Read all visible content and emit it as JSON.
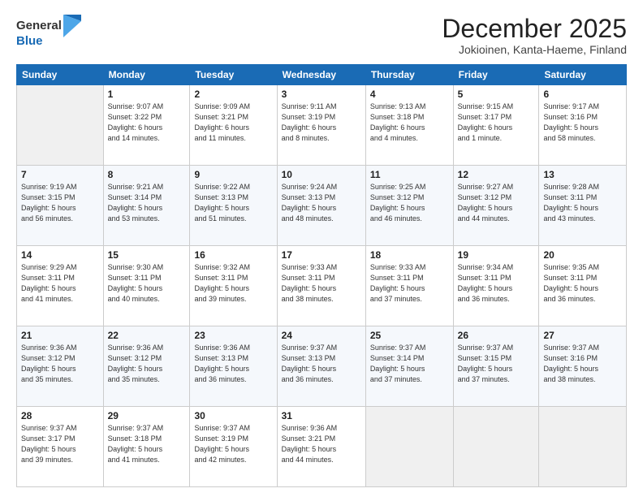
{
  "header": {
    "logo_general": "General",
    "logo_blue": "Blue",
    "month": "December 2025",
    "location": "Jokioinen, Kanta-Haeme, Finland"
  },
  "days_of_week": [
    "Sunday",
    "Monday",
    "Tuesday",
    "Wednesday",
    "Thursday",
    "Friday",
    "Saturday"
  ],
  "weeks": [
    [
      {
        "day": "",
        "info": ""
      },
      {
        "day": "1",
        "info": "Sunrise: 9:07 AM\nSunset: 3:22 PM\nDaylight: 6 hours\nand 14 minutes."
      },
      {
        "day": "2",
        "info": "Sunrise: 9:09 AM\nSunset: 3:21 PM\nDaylight: 6 hours\nand 11 minutes."
      },
      {
        "day": "3",
        "info": "Sunrise: 9:11 AM\nSunset: 3:19 PM\nDaylight: 6 hours\nand 8 minutes."
      },
      {
        "day": "4",
        "info": "Sunrise: 9:13 AM\nSunset: 3:18 PM\nDaylight: 6 hours\nand 4 minutes."
      },
      {
        "day": "5",
        "info": "Sunrise: 9:15 AM\nSunset: 3:17 PM\nDaylight: 6 hours\nand 1 minute."
      },
      {
        "day": "6",
        "info": "Sunrise: 9:17 AM\nSunset: 3:16 PM\nDaylight: 5 hours\nand 58 minutes."
      }
    ],
    [
      {
        "day": "7",
        "info": "Sunrise: 9:19 AM\nSunset: 3:15 PM\nDaylight: 5 hours\nand 56 minutes."
      },
      {
        "day": "8",
        "info": "Sunrise: 9:21 AM\nSunset: 3:14 PM\nDaylight: 5 hours\nand 53 minutes."
      },
      {
        "day": "9",
        "info": "Sunrise: 9:22 AM\nSunset: 3:13 PM\nDaylight: 5 hours\nand 51 minutes."
      },
      {
        "day": "10",
        "info": "Sunrise: 9:24 AM\nSunset: 3:13 PM\nDaylight: 5 hours\nand 48 minutes."
      },
      {
        "day": "11",
        "info": "Sunrise: 9:25 AM\nSunset: 3:12 PM\nDaylight: 5 hours\nand 46 minutes."
      },
      {
        "day": "12",
        "info": "Sunrise: 9:27 AM\nSunset: 3:12 PM\nDaylight: 5 hours\nand 44 minutes."
      },
      {
        "day": "13",
        "info": "Sunrise: 9:28 AM\nSunset: 3:11 PM\nDaylight: 5 hours\nand 43 minutes."
      }
    ],
    [
      {
        "day": "14",
        "info": "Sunrise: 9:29 AM\nSunset: 3:11 PM\nDaylight: 5 hours\nand 41 minutes."
      },
      {
        "day": "15",
        "info": "Sunrise: 9:30 AM\nSunset: 3:11 PM\nDaylight: 5 hours\nand 40 minutes."
      },
      {
        "day": "16",
        "info": "Sunrise: 9:32 AM\nSunset: 3:11 PM\nDaylight: 5 hours\nand 39 minutes."
      },
      {
        "day": "17",
        "info": "Sunrise: 9:33 AM\nSunset: 3:11 PM\nDaylight: 5 hours\nand 38 minutes."
      },
      {
        "day": "18",
        "info": "Sunrise: 9:33 AM\nSunset: 3:11 PM\nDaylight: 5 hours\nand 37 minutes."
      },
      {
        "day": "19",
        "info": "Sunrise: 9:34 AM\nSunset: 3:11 PM\nDaylight: 5 hours\nand 36 minutes."
      },
      {
        "day": "20",
        "info": "Sunrise: 9:35 AM\nSunset: 3:11 PM\nDaylight: 5 hours\nand 36 minutes."
      }
    ],
    [
      {
        "day": "21",
        "info": "Sunrise: 9:36 AM\nSunset: 3:12 PM\nDaylight: 5 hours\nand 35 minutes."
      },
      {
        "day": "22",
        "info": "Sunrise: 9:36 AM\nSunset: 3:12 PM\nDaylight: 5 hours\nand 35 minutes."
      },
      {
        "day": "23",
        "info": "Sunrise: 9:36 AM\nSunset: 3:13 PM\nDaylight: 5 hours\nand 36 minutes."
      },
      {
        "day": "24",
        "info": "Sunrise: 9:37 AM\nSunset: 3:13 PM\nDaylight: 5 hours\nand 36 minutes."
      },
      {
        "day": "25",
        "info": "Sunrise: 9:37 AM\nSunset: 3:14 PM\nDaylight: 5 hours\nand 37 minutes."
      },
      {
        "day": "26",
        "info": "Sunrise: 9:37 AM\nSunset: 3:15 PM\nDaylight: 5 hours\nand 37 minutes."
      },
      {
        "day": "27",
        "info": "Sunrise: 9:37 AM\nSunset: 3:16 PM\nDaylight: 5 hours\nand 38 minutes."
      }
    ],
    [
      {
        "day": "28",
        "info": "Sunrise: 9:37 AM\nSunset: 3:17 PM\nDaylight: 5 hours\nand 39 minutes."
      },
      {
        "day": "29",
        "info": "Sunrise: 9:37 AM\nSunset: 3:18 PM\nDaylight: 5 hours\nand 41 minutes."
      },
      {
        "day": "30",
        "info": "Sunrise: 9:37 AM\nSunset: 3:19 PM\nDaylight: 5 hours\nand 42 minutes."
      },
      {
        "day": "31",
        "info": "Sunrise: 9:36 AM\nSunset: 3:21 PM\nDaylight: 5 hours\nand 44 minutes."
      },
      {
        "day": "",
        "info": ""
      },
      {
        "day": "",
        "info": ""
      },
      {
        "day": "",
        "info": ""
      }
    ]
  ]
}
